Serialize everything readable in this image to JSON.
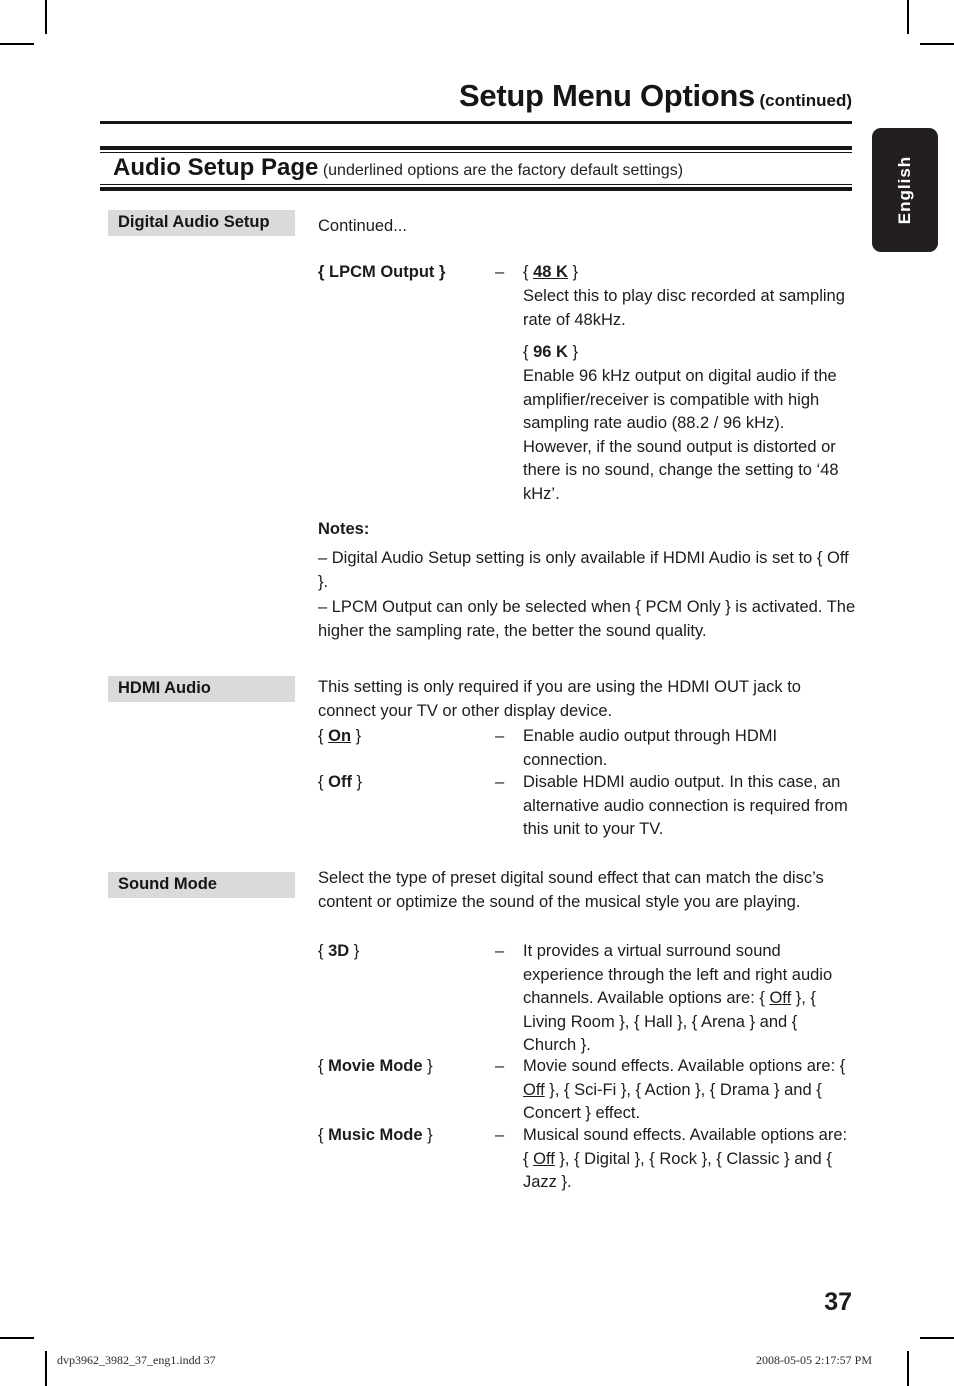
{
  "header": {
    "running_title": "Setup Menu Options",
    "running_continued": "(continued)",
    "section_title": "Audio Setup Page",
    "section_subtitle": "(underlined options are the factory default settings)"
  },
  "language_tab": {
    "label": "English"
  },
  "sections": {
    "digital_audio_setup": {
      "label": "Digital Audio Setup",
      "continued_note": "Continued...",
      "lpcm": {
        "option_name": "{ LPCM Output }",
        "dash": "–",
        "value_48k_open": "{ ",
        "value_48k": "48 K",
        "value_48k_close": " }",
        "desc_48k": "Select this to play disc recorded at sampling rate of 48kHz.",
        "value_96k_open": "{ ",
        "value_96k": "96 K",
        "value_96k_close": " }",
        "desc_96k": "Enable 96 kHz output on digital audio if the amplifier/receiver is compatible with high sampling rate audio (88.2 / 96 kHz). However, if the sound output is distorted or there is no sound, change the setting to ‘48 kHz’."
      },
      "notes_heading": "Notes:",
      "note_1": "–  Digital Audio Setup setting is only available if HDMI Audio is set to { Off }.",
      "note_2": "–  LPCM Output can only be selected when { PCM Only } is activated. The higher the sampling rate, the better the sound quality."
    },
    "hdmi_audio": {
      "label": "HDMI Audio",
      "intro": "This setting is only required if you are using the HDMI OUT jack to connect your TV or other display device.",
      "options": [
        {
          "open": "{ ",
          "name": "On",
          "close": " }",
          "underlined": true,
          "dash": "–",
          "desc": "Enable audio output through HDMI connection."
        },
        {
          "open": "{ ",
          "name": "Off",
          "close": " }",
          "underlined": false,
          "dash": "–",
          "desc": "Disable HDMI audio output. In this case, an alternative audio connection is required from this unit to your TV."
        }
      ]
    },
    "sound_mode": {
      "label": "Sound Mode",
      "intro": "Select the type of preset digital sound effect that can match the disc’s content or optimize the sound of the musical style you are playing.",
      "options": [
        {
          "open": "{ ",
          "name": "3D",
          "close": " }",
          "dash": "–",
          "desc_pre": "It provides a virtual surround sound experience through the left and right audio channels. Available options are: { ",
          "desc_default": "Off",
          "desc_post": " }, { Living Room }, { Hall }, { Arena } and { Church }."
        },
        {
          "open": "{ ",
          "name": "Movie Mode",
          "close": " }",
          "dash": "–",
          "desc_pre": "Movie sound effects. Available options are: { ",
          "desc_default": "Off",
          "desc_post": " }, { Sci-Fi }, { Action }, { Drama } and { Concert } effect."
        },
        {
          "open": "{ ",
          "name": "Music Mode",
          "close": " }",
          "dash": "–",
          "desc_pre": "Musical sound effects. Available options are: { ",
          "desc_default": "Off",
          "desc_post": " }, { Digital }, { Rock }, { Classic } and { Jazz }."
        }
      ]
    }
  },
  "footer": {
    "page_number": "37",
    "file_name": "dvp3962_3982_37_eng1.indd   37",
    "timestamp": "2008-05-05   2:17:57 PM"
  }
}
